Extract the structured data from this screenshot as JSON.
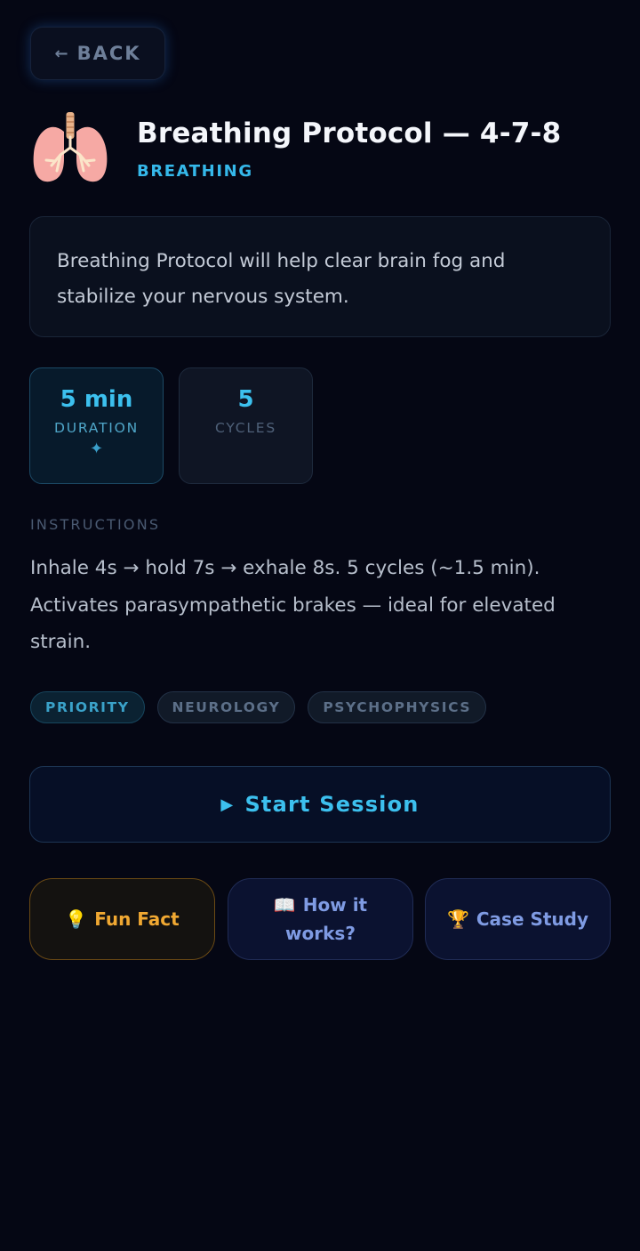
{
  "nav": {
    "back_label": "BACK",
    "back_arrow": "←"
  },
  "header": {
    "title": "Breathing Protocol — 4-7-8",
    "category": "BREATHING",
    "icon": "lungs-icon"
  },
  "description": "Breathing Protocol will help clear brain fog and stabilize your nervous system.",
  "stats": [
    {
      "value": "5 min",
      "label": "DURATION",
      "selected": true,
      "sparkle": "✦"
    },
    {
      "value": "5",
      "label": "CYCLES",
      "selected": false
    }
  ],
  "instructions": {
    "label": "INSTRUCTIONS",
    "text": "Inhale 4s → hold 7s → exhale 8s. 5 cycles (~1.5 min). Activates parasympathetic brakes — ideal for elevated strain."
  },
  "tags": [
    "PRIORITY",
    "NEUROLOGY",
    "PSYCHOPHYSICS"
  ],
  "start_button": {
    "icon": "▶",
    "label": "Start Session"
  },
  "actions": [
    {
      "icon": "💡",
      "label": "Fun Fact"
    },
    {
      "icon": "📖",
      "label": "How it works?"
    },
    {
      "icon": "🏆",
      "label": "Case Study"
    }
  ],
  "colors": {
    "background": "#050714",
    "accent": "#3cc0ee",
    "fun_fact": "#f0a832",
    "secondary_action": "#7f9be3"
  }
}
